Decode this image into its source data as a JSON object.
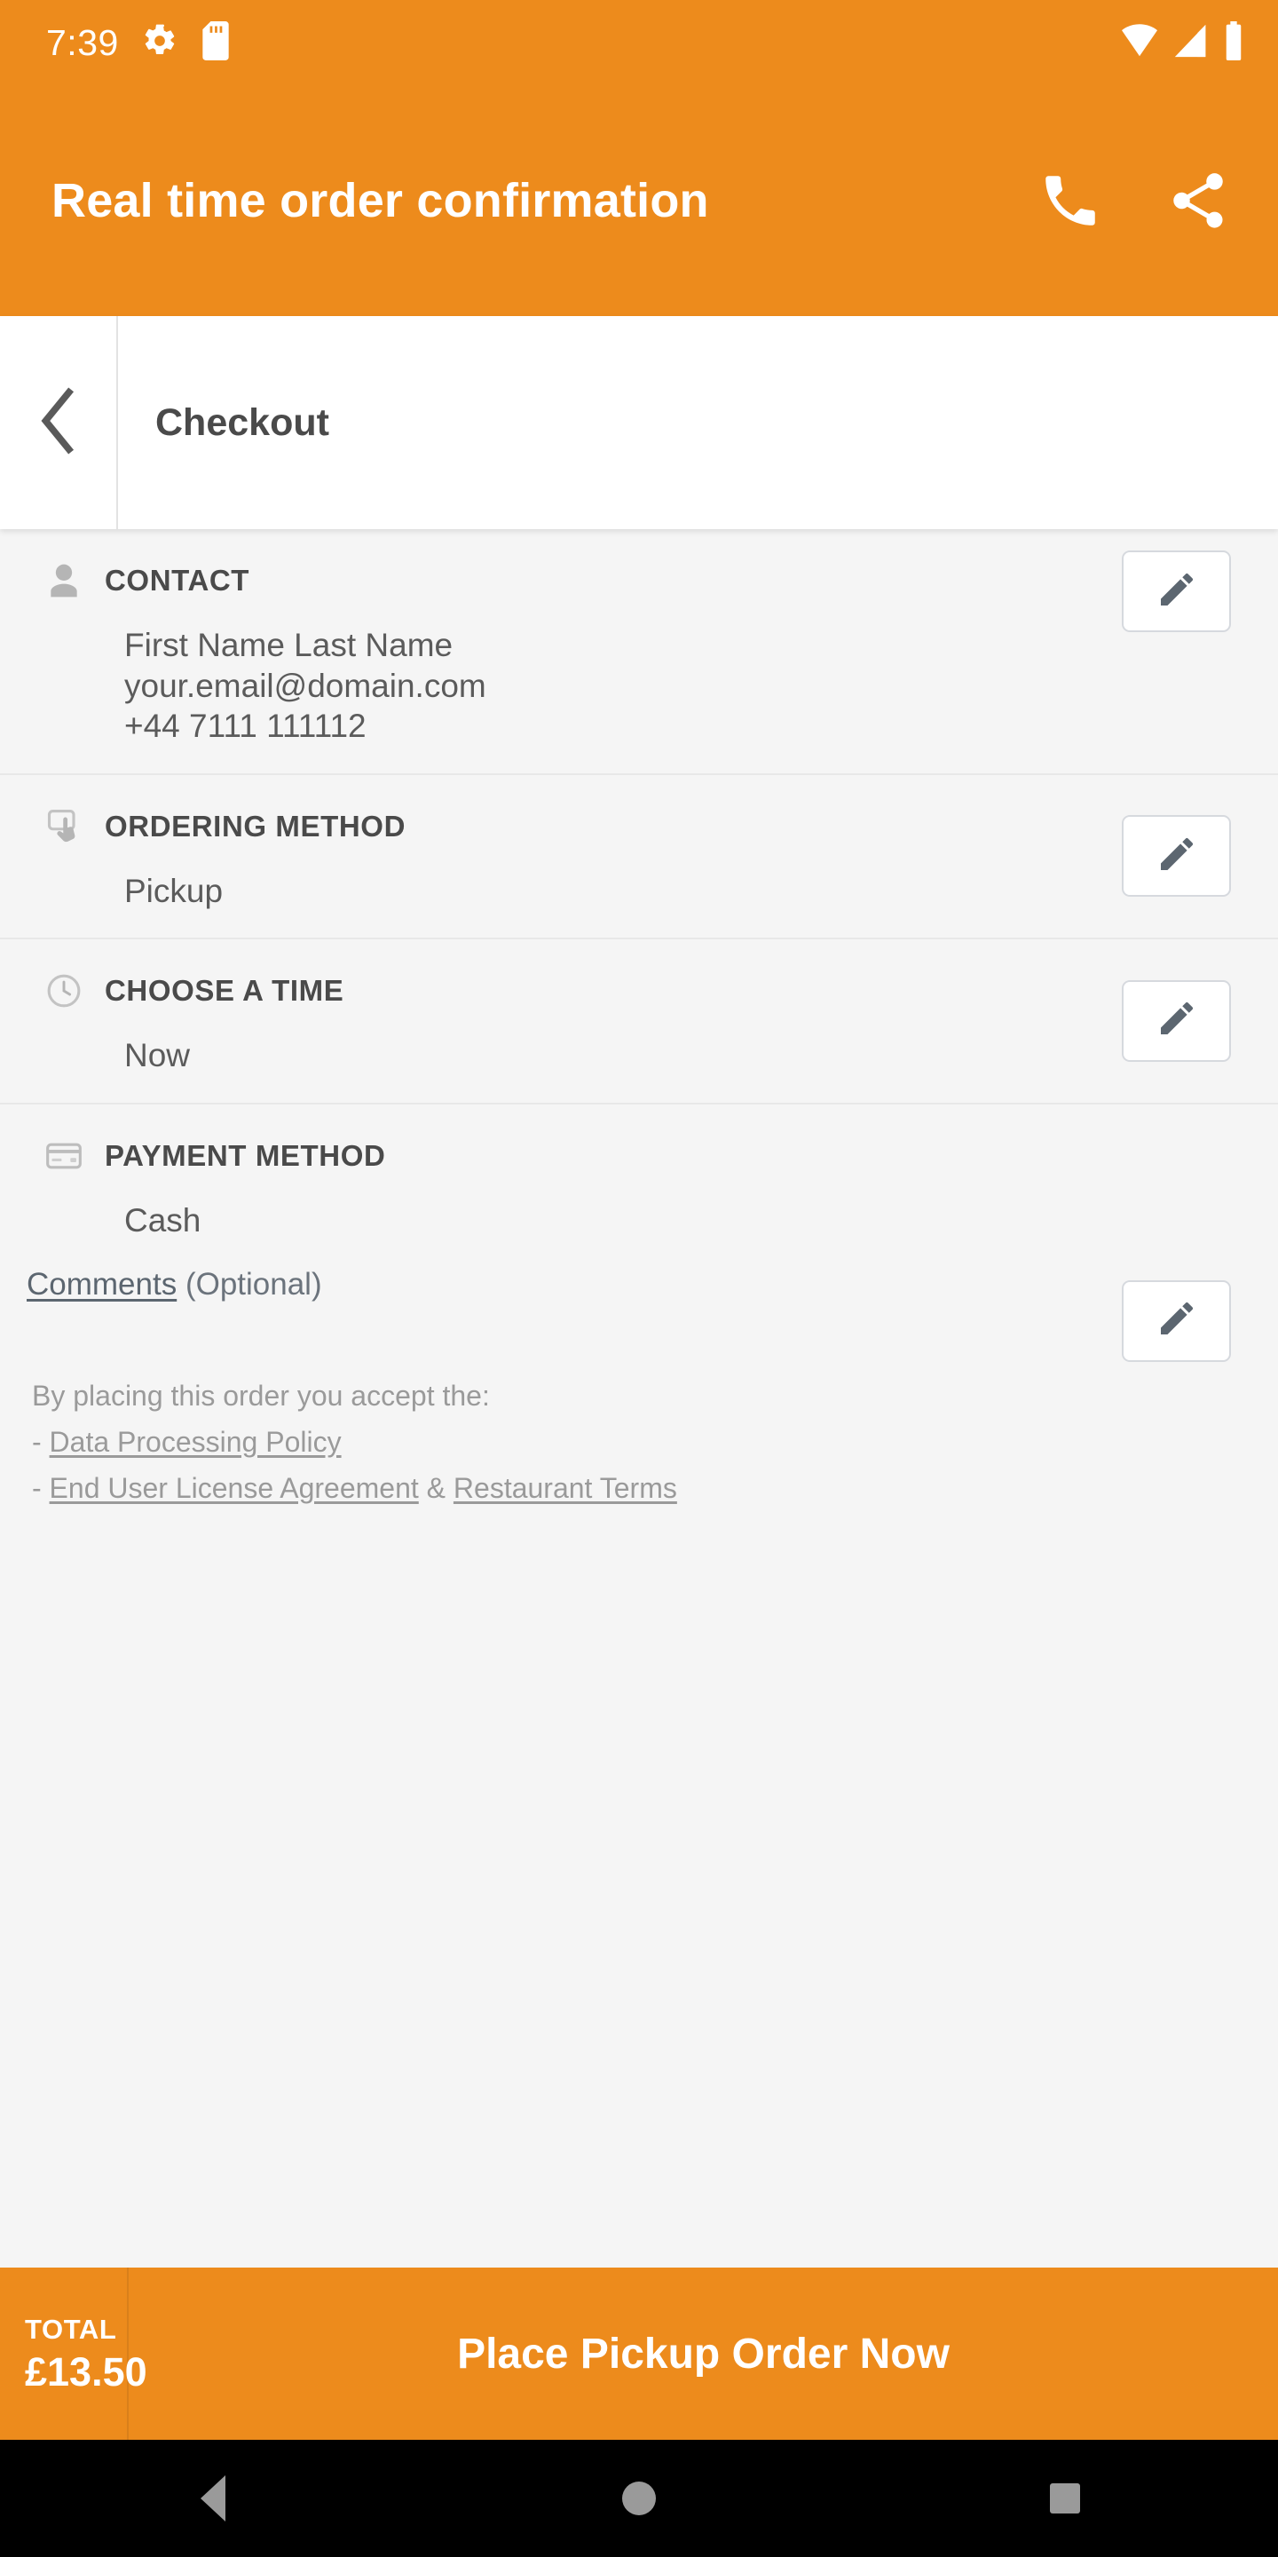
{
  "status_bar": {
    "time": "7:39",
    "icons": [
      "gear-icon",
      "sd-card-icon",
      "wifi-icon",
      "cellular-signal-icon",
      "battery-icon"
    ]
  },
  "app_bar": {
    "title": "Real time order confirmation",
    "actions": [
      "phone-icon",
      "share-icon"
    ]
  },
  "checkout_bar": {
    "back_label": "back-chevron-icon",
    "title": "Checkout"
  },
  "sections": {
    "contact": {
      "title": "CONTACT",
      "icon": "person-icon",
      "lines": [
        "First Name Last Name",
        "your.email@domain.com",
        "+44 7111 111112"
      ],
      "edit_label": "pencil-icon"
    },
    "ordering_method": {
      "title": "ORDERING METHOD",
      "icon": "tap-hand-icon",
      "value": "Pickup",
      "edit_label": "pencil-icon"
    },
    "choose_time": {
      "title": "CHOOSE A TIME",
      "icon": "clock-icon",
      "value": "Now",
      "edit_label": "pencil-icon"
    },
    "payment_method": {
      "title": "PAYMENT METHOD",
      "icon": "credit-card-icon",
      "value": "Cash",
      "edit_label": "pencil-icon"
    }
  },
  "comments": {
    "link_label": "Comments",
    "optional_label": " (Optional)"
  },
  "terms": {
    "intro": "By placing this order you accept the:",
    "dash": "- ",
    "data_policy": "Data Processing Policy",
    "eula": "End User License Agreement",
    "conjunction": " & ",
    "restaurant_terms": "Restaurant Terms"
  },
  "order_bar": {
    "total_label": "TOTAL",
    "total_amount": "£13.50",
    "place_order_label": "Place Pickup Order Now"
  },
  "nav_bar": {
    "back": "back-triangle-icon",
    "home": "home-circle-icon",
    "recents": "recents-square-icon"
  },
  "colors": {
    "brand_orange": "#ED8B1C",
    "page_background": "#f5f5f5",
    "heading_text": "#4a4a4a",
    "body_text": "#5b5b5b",
    "muted_text": "#9a9a9a",
    "icon_slate": "#5c6670",
    "nav_bar_background": "#000000"
  }
}
